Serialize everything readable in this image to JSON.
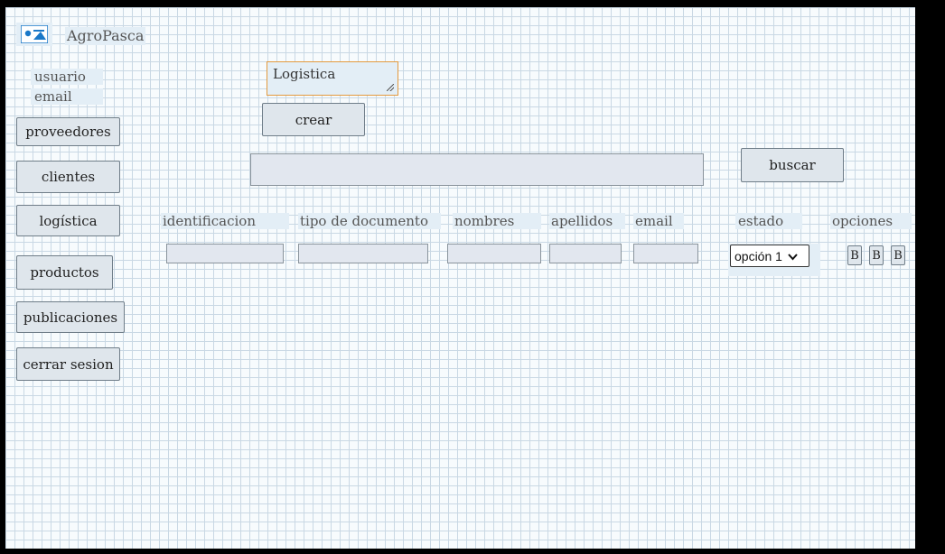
{
  "app": {
    "name": "AgroPasca",
    "logo_icon": "image-icon"
  },
  "user": {
    "name": "usuario",
    "email": "email"
  },
  "sidebar": {
    "items": [
      {
        "label": "proveedores"
      },
      {
        "label": "clientes"
      },
      {
        "label": "logística"
      },
      {
        "label": "productos"
      },
      {
        "label": "publicaciones"
      },
      {
        "label": "cerrar sesion"
      }
    ]
  },
  "main": {
    "section_title": "Logistica",
    "create_label": "crear",
    "search": {
      "value": "",
      "button_label": "buscar"
    },
    "table": {
      "headers": [
        "identificacion",
        "tipo de documento",
        "nombres",
        "apellidos",
        "email",
        "estado",
        "opciones"
      ],
      "row": {
        "identificacion": "",
        "tipo_documento": "",
        "nombres": "",
        "apellidos": "",
        "email": "",
        "estado_selected": "opción 1",
        "options": [
          "B",
          "B",
          "B"
        ]
      }
    }
  },
  "colors": {
    "grid_background": "#f7fbfd",
    "grid_lines": "#c9d8e4",
    "label_bg": "#e3eef6",
    "button_bg": "#dfe6ec",
    "focus_border": "#e39a3e"
  }
}
